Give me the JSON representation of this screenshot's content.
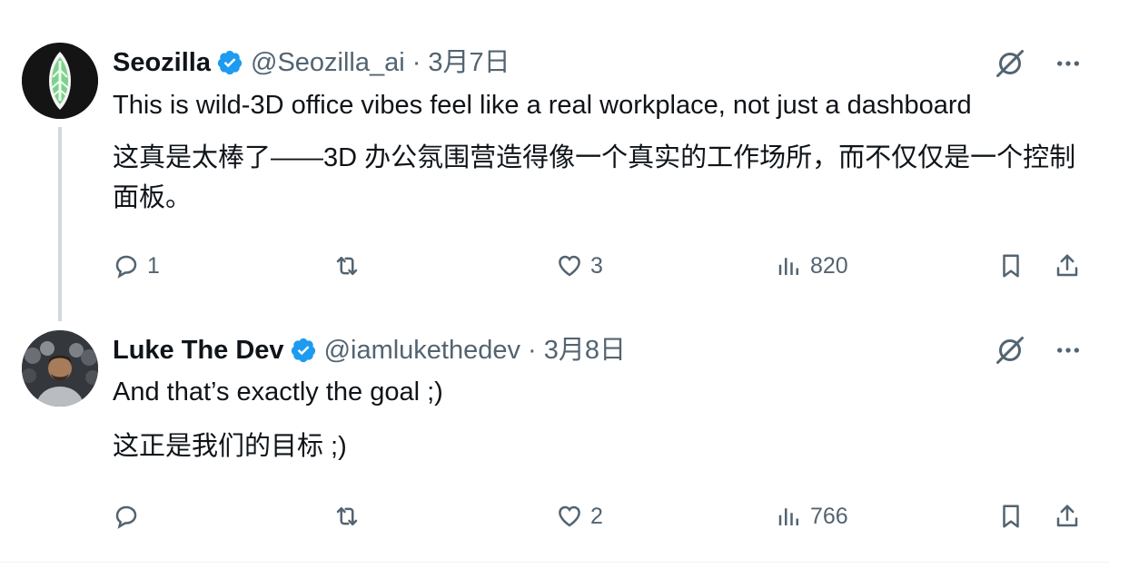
{
  "tweets": [
    {
      "name": "Seozilla",
      "handle": "@Seozilla_ai",
      "sep": "·",
      "date": "3月7日",
      "text_en": "This is wild-3D office vibes feel like a real workplace, not just a dashboard",
      "text_zh": "这真是太棒了——3D 办公氛围营造得像一个真实的工作场所，而不仅仅是一个控制面板。",
      "replies": "1",
      "reposts": "",
      "likes": "3",
      "views": "820"
    },
    {
      "name": "Luke The Dev",
      "handle": "@iamlukethedev",
      "sep": "·",
      "date": "3月8日",
      "text_en": "And that’s exactly the goal ;)",
      "text_zh": "这正是我们的目标 ;)",
      "replies": "",
      "reposts": "",
      "likes": "2",
      "views": "766"
    }
  ],
  "colors": {
    "verified": "#1d9bf0",
    "muted": "#536471",
    "text": "#0f1419",
    "thread_line": "#cfd9de"
  }
}
